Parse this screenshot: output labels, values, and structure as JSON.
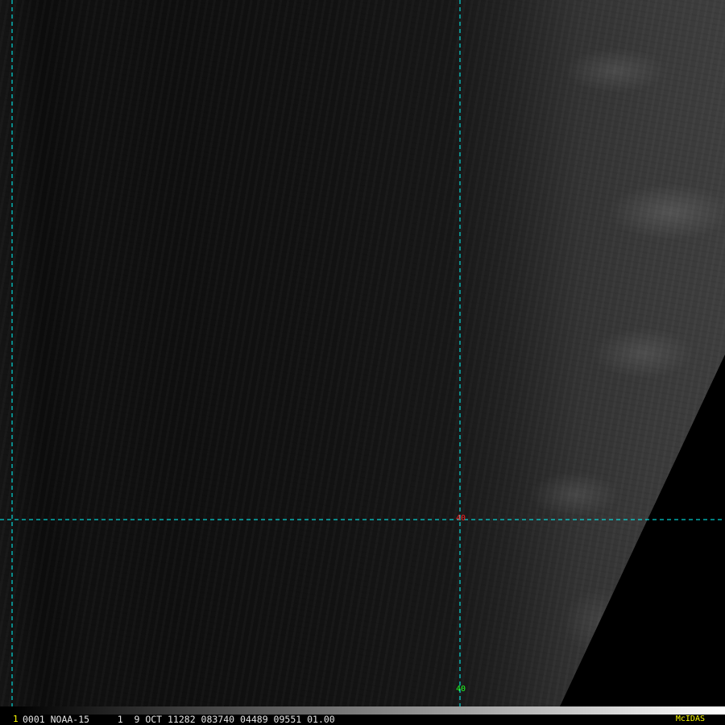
{
  "image": {
    "description_colors": {
      "grid_line": "#00ffff",
      "no_data": "#000000"
    }
  },
  "grid_labels": {
    "latitude": "40",
    "longitude": "40"
  },
  "status_bar": {
    "frame_number": "1",
    "text": "0001 NOAA-15     1  9 OCT 11282 083740 04489 09551 01.00",
    "brand": "McIDAS"
  },
  "colors": {
    "latitude_label": "#ff2020",
    "longitude_label": "#20ff20",
    "frame_number": "#ffff00",
    "brand": "#ffff00"
  }
}
